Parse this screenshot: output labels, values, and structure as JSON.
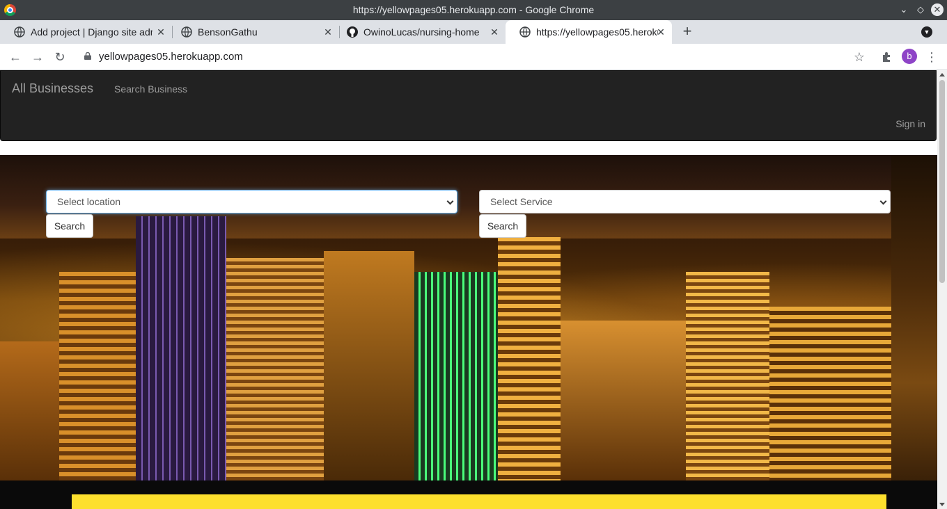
{
  "window": {
    "title": "https://yellowpages05.herokuapp.com - Google Chrome"
  },
  "tabs": [
    {
      "label": "Add project | Django site adm",
      "icon": "globe-icon",
      "active": false
    },
    {
      "label": "BensonGathu",
      "icon": "globe-icon",
      "active": false
    },
    {
      "label": "OwinoLucas/nursing-home",
      "icon": "github-icon",
      "active": false
    },
    {
      "label": "https://yellowpages05.heroku",
      "icon": "globe-icon",
      "active": true
    }
  ],
  "toolbar": {
    "url": "yellowpages05.herokuapp.com",
    "profile_initial": "b"
  },
  "navbar": {
    "brand": "All Businesses",
    "links": [
      "Search Business"
    ],
    "signin": "Sign in"
  },
  "search": {
    "location_placeholder": "Select location",
    "service_placeholder": "Select Service",
    "button_label": "Search"
  },
  "colors": {
    "navbar_bg": "#222222",
    "accent_yellow": "#fde02e",
    "chrome_frame": "#3c4043",
    "tabstrip": "#dee1e6"
  }
}
